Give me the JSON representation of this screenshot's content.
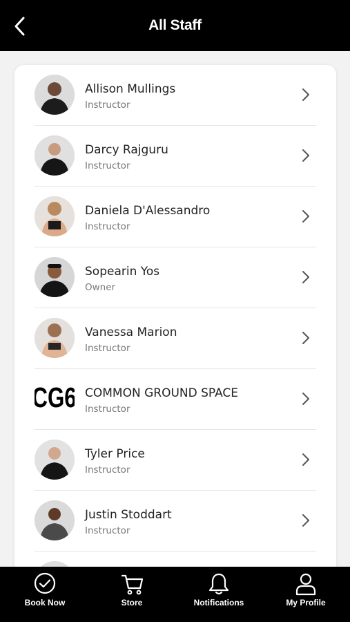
{
  "header": {
    "title": "All Staff"
  },
  "staff": [
    {
      "name": "Allison Mullings",
      "role": "Instructor"
    },
    {
      "name": "Darcy Rajguru",
      "role": "Instructor"
    },
    {
      "name": "Daniela D'Alessandro",
      "role": "Instructor"
    },
    {
      "name": "Sopearin Yos",
      "role": "Owner"
    },
    {
      "name": "Vanessa Marion",
      "role": "Instructor"
    },
    {
      "name": "COMMON GROUND SPACE",
      "role": "Instructor",
      "logo_text": "CG6"
    },
    {
      "name": "Tyler Price",
      "role": "Instructor"
    },
    {
      "name": "Justin Stoddart",
      "role": "Instructor"
    }
  ],
  "tabs": [
    {
      "label": "Book Now",
      "icon": "check-circle-icon"
    },
    {
      "label": "Store",
      "icon": "cart-icon"
    },
    {
      "label": "Notifications",
      "icon": "bell-icon"
    },
    {
      "label": "My Profile",
      "icon": "user-icon"
    }
  ],
  "colors": {
    "header_bg": "#000000",
    "tabbar_bg": "#000000",
    "card_bg": "#ffffff",
    "page_bg": "#f2f2f2"
  }
}
